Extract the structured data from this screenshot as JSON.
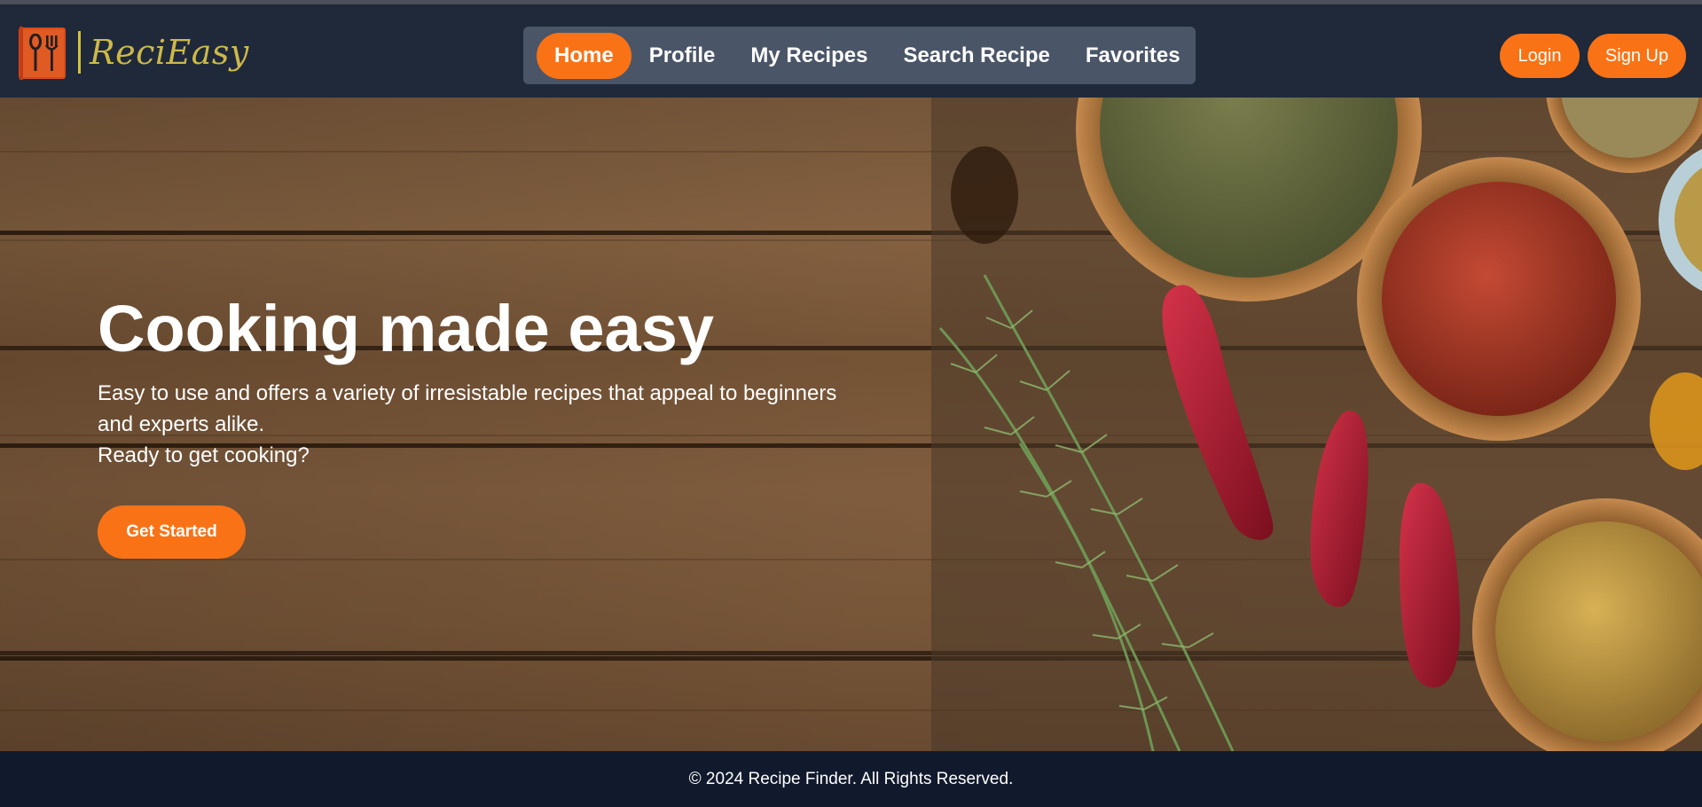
{
  "brand": {
    "name": "ReciEasy"
  },
  "nav": {
    "items": [
      {
        "label": "Home",
        "active": true
      },
      {
        "label": "Profile",
        "active": false
      },
      {
        "label": "My Recipes",
        "active": false
      },
      {
        "label": "Search Recipe",
        "active": false
      },
      {
        "label": "Favorites",
        "active": false
      }
    ]
  },
  "auth": {
    "login_label": "Login",
    "signup_label": "Sign Up"
  },
  "hero": {
    "title": "Cooking made easy",
    "description_line1": "Easy to use and offers a variety of irresistable recipes that appeal to beginners and experts alike.",
    "description_line2": "Ready to get cooking?",
    "cta_label": "Get Started"
  },
  "footer": {
    "text": "© 2024 Recipe Finder. All Rights Reserved."
  },
  "colors": {
    "accent": "#f97316",
    "navbar": "#1f293a",
    "nav_pill": "#4a5568",
    "footer": "#111a2c"
  },
  "icons": {
    "logo": "fork-knife-icon"
  }
}
